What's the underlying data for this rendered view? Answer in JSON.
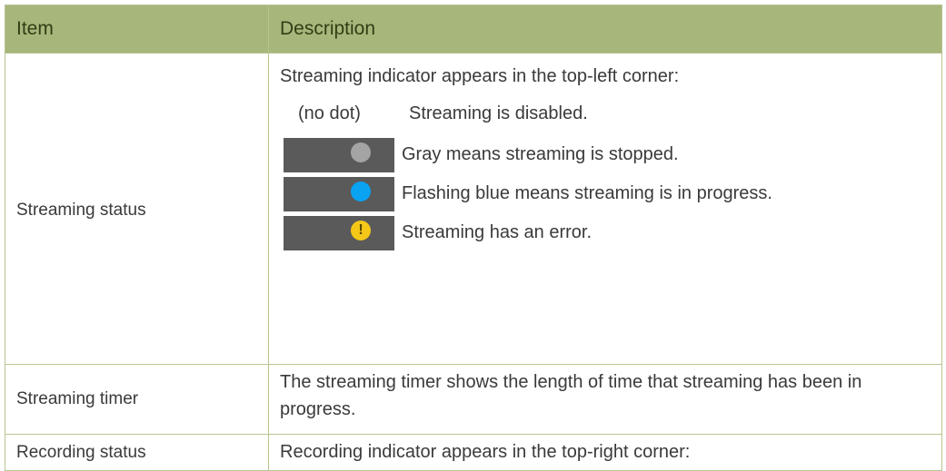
{
  "header": {
    "col_item": "Item",
    "col_description": "Description"
  },
  "rows": [
    {
      "item": "Streaming status",
      "intro": "Streaming indicator appears in the top-left corner:",
      "indicators": [
        {
          "badge": "(no dot)",
          "text": "Streaming is disabled."
        },
        {
          "icon": "gray-dot-icon",
          "color": "#a4a4a4",
          "text": "Gray means streaming is stopped."
        },
        {
          "icon": "blue-dot-icon",
          "color": "#0aa2f2",
          "text": "Flashing blue means streaming is in progress."
        },
        {
          "icon": "warning-dot-icon",
          "color": "#f4c718",
          "text": "Streaming has an error."
        }
      ]
    },
    {
      "item": "Streaming timer",
      "description": "The streaming timer shows the length of time that streaming has been in progress."
    },
    {
      "item": "Recording status",
      "description": "Recording indicator appears in the top-right corner:"
    }
  ],
  "colors": {
    "header_bg": "#a7b77c",
    "header_text": "#2f3f14",
    "border": "#b7c48f",
    "indicator_bar": "#5a5a5a"
  }
}
